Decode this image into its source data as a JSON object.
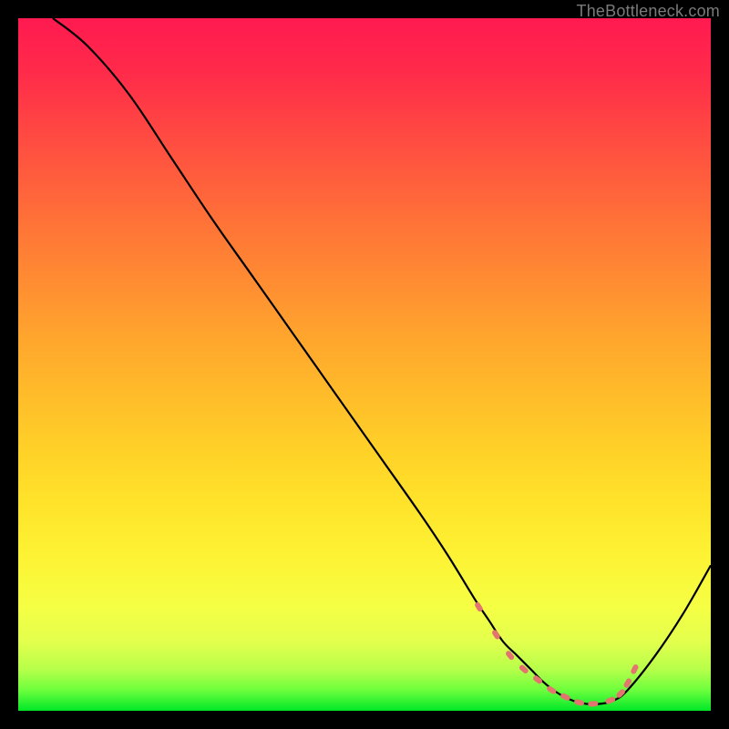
{
  "watermark": "TheBottleneck.com",
  "chart_data": {
    "type": "line",
    "title": "",
    "xlabel": "",
    "ylabel": "",
    "xlim": [
      0,
      100
    ],
    "ylim": [
      0,
      100
    ],
    "grid": false,
    "series": [
      {
        "name": "curve",
        "x": [
          5,
          10,
          16,
          22,
          28,
          34,
          40,
          46,
          52,
          58,
          62,
          66,
          68,
          70,
          72,
          74,
          76,
          78,
          80,
          82,
          84,
          86,
          88,
          92,
          96,
          100
        ],
        "y": [
          100,
          96,
          89,
          80,
          71,
          62.5,
          54,
          45.5,
          37,
          28.5,
          22.5,
          16,
          13,
          10,
          8,
          6,
          4,
          2.5,
          1.5,
          1,
          1,
          1.5,
          3,
          8,
          14,
          21
        ]
      }
    ],
    "markers": {
      "name": "minimum-region",
      "x": [
        66.5,
        69,
        71,
        73,
        75,
        77,
        79,
        81,
        83,
        85.5,
        87,
        88,
        89
      ],
      "y": [
        15,
        11,
        8,
        6,
        4.5,
        3,
        2,
        1.2,
        1,
        1.5,
        2.5,
        4,
        6
      ]
    }
  }
}
